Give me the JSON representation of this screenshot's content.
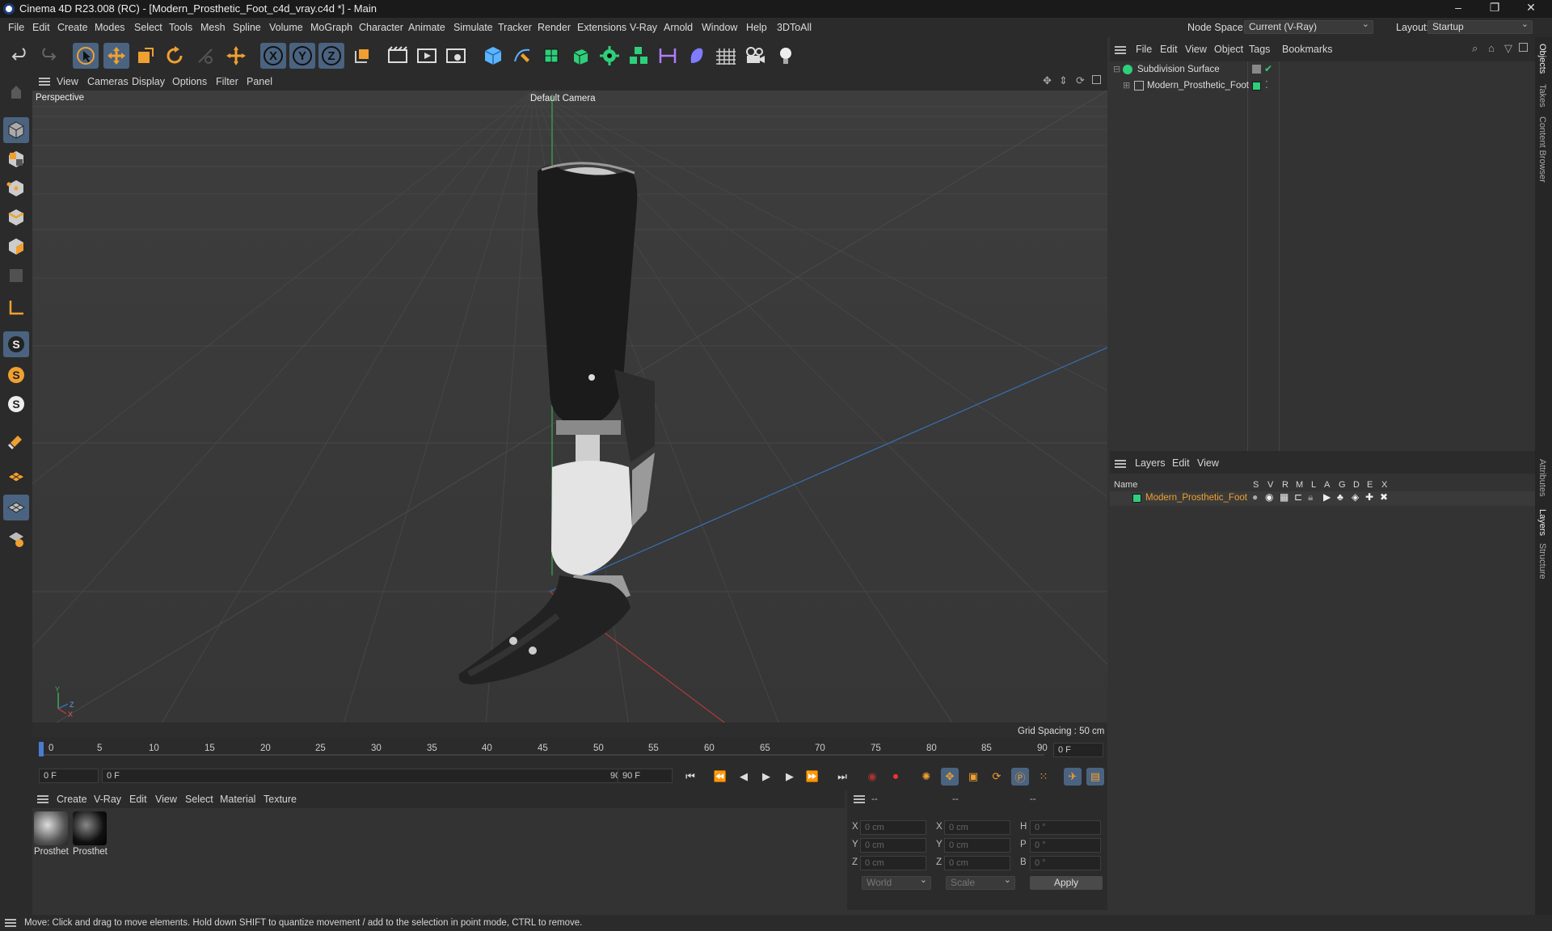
{
  "window": {
    "title": "Cinema 4D R23.008 (RC) - [Modern_Prosthetic_Foot_c4d_vray.c4d *] - Main",
    "minimize": "–",
    "maximize": "❐",
    "close": "✕"
  },
  "menubar": {
    "items": [
      "File",
      "Edit",
      "Create",
      "Modes",
      "Select",
      "Tools",
      "Mesh",
      "Spline",
      "Volume",
      "MoGraph",
      "Character",
      "Animate",
      "Simulate",
      "Tracker",
      "Render",
      "Extensions",
      "V-Ray",
      "Arnold",
      "Window",
      "Help",
      "3DToAll"
    ],
    "node_space_label": "Node Space:",
    "node_space_value": "Current (V-Ray)",
    "layout_label": "Layout:",
    "layout_value": "Startup"
  },
  "toolbar": {
    "icons": [
      "undo-icon",
      "redo-icon",
      "live-selection-icon",
      "move-icon",
      "scale-icon",
      "rotate-icon",
      "recent-tools-icon",
      "axis-x-icon",
      "axis-y-icon",
      "axis-z-icon",
      "coordinate-system-icon",
      "render-view-icon",
      "render-picture-viewer-icon",
      "render-settings-icon",
      "cube-icon",
      "pen-icon",
      "subdivision-icon",
      "extrude-icon",
      "cloner-icon",
      "array-icon",
      "symmetry-icon",
      "deformer-icon",
      "floor-icon",
      "camera-icon",
      "light-icon"
    ],
    "axis_x": "X",
    "axis_y": "Y",
    "axis_z": "Z"
  },
  "left_tools": [
    "model-mode-icon",
    "texture-mode-icon",
    "points-mode-icon",
    "edges-mode-icon",
    "polygons-mode-icon",
    "uv-mode-icon",
    "axis-mode-icon",
    "snap-s-icon",
    "snap-s2-icon",
    "snap-s3-icon",
    "magnet-icon",
    "workplane-icon",
    "grid-icon",
    "grid-lock-icon"
  ],
  "viewport": {
    "menu": [
      "View",
      "Cameras",
      "Display",
      "Options",
      "Filter",
      "Panel"
    ],
    "label": "Perspective",
    "camera": "Default Camera",
    "grid_spacing": "Grid Spacing : 50 cm",
    "axis_y": "Y",
    "axis_z": "Z",
    "axis_x": "X"
  },
  "timeline": {
    "ticks": [
      "0",
      "5",
      "10",
      "15",
      "20",
      "25",
      "30",
      "35",
      "40",
      "45",
      "50",
      "55",
      "60",
      "65",
      "70",
      "75",
      "80",
      "85",
      "90"
    ],
    "current_frame": "0 F"
  },
  "transport": {
    "start": "0 F",
    "range_start": "0 F",
    "range_end": "90 F",
    "end": "90 F"
  },
  "material_manager": {
    "menu": [
      "Create",
      "V-Ray",
      "Edit",
      "View",
      "Select",
      "Material",
      "Texture"
    ],
    "materials": [
      {
        "name": "Prosthet"
      },
      {
        "name": "Prosthet"
      }
    ]
  },
  "coordinates": {
    "header": [
      "--",
      "--",
      "--"
    ],
    "rows": [
      {
        "a": "X",
        "av": "0 cm",
        "b": "X",
        "bv": "0 cm",
        "c": "H",
        "cv": "0 °"
      },
      {
        "a": "Y",
        "av": "0 cm",
        "b": "Y",
        "bv": "0 cm",
        "c": "P",
        "cv": "0 °"
      },
      {
        "a": "Z",
        "av": "0 cm",
        "b": "Z",
        "bv": "0 cm",
        "c": "B",
        "cv": "0 °"
      }
    ],
    "world": "World",
    "scale": "Scale",
    "apply": "Apply"
  },
  "object_manager": {
    "menu": [
      "File",
      "Edit",
      "View",
      "Object",
      "Tags",
      "Bookmarks"
    ],
    "objects": [
      {
        "name": "Subdivision Surface"
      },
      {
        "name": "Modern_Prosthetic_Foot"
      }
    ]
  },
  "layers": {
    "menu": [
      "Layers",
      "Edit",
      "View"
    ],
    "header_name": "Name",
    "flags": [
      "S",
      "V",
      "R",
      "M",
      "L",
      "A",
      "G",
      "D",
      "E",
      "X"
    ],
    "rows": [
      {
        "name": "Modern_Prosthetic_Foot",
        "color": "#2fce7a"
      }
    ]
  },
  "side_tabs": [
    "Objects",
    "Takes",
    "Content Browser",
    "Attributes",
    "Layers",
    "Structure"
  ],
  "status": "Move: Click and drag to move elements. Hold down SHIFT to quantize movement / add to the selection in point mode, CTRL to remove.",
  "colors": {
    "accent": "#4a6380",
    "layer_green": "#2fce7a",
    "layer_text": "#f0a030"
  }
}
